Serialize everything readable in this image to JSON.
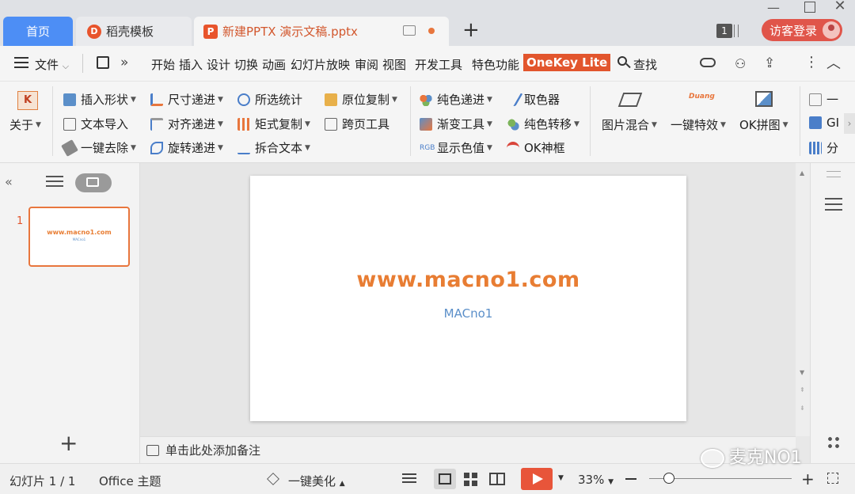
{
  "tabs": {
    "home": "首页",
    "template": "稻壳模板",
    "document": "新建PPTX 演示文稿.pptx",
    "add": "+"
  },
  "window": {
    "badge": "1",
    "login": "访客登录"
  },
  "menu": {
    "file": "文件",
    "items": [
      "开始",
      "插入",
      "设计",
      "切换",
      "动画",
      "幻灯片放映",
      "审阅",
      "视图",
      "开发工具",
      "特色功能"
    ],
    "onekey": "OneKey Lite",
    "search": "查找"
  },
  "ribbon": {
    "about": "关于",
    "insert_shape": "插入形状",
    "text_import": "文本导入",
    "one_key_remove": "一键去除",
    "size_step": "尺寸递进",
    "align_step": "对齐递进",
    "rotate_step": "旋转递进",
    "selected_stats": "所选统计",
    "matrix_copy": "矩式复制",
    "split_text": "拆合文本",
    "copy_in_place": "原位复制",
    "cross_page": "跨页工具",
    "pure_color_step": "纯色递进",
    "gradient_tool": "渐变工具",
    "show_color_value": "显示色值",
    "color_picker": "取色器",
    "pure_color_transfer": "纯色转移",
    "ok_frame": "OK神框",
    "image_blend": "图片混合",
    "one_key_effect": "一键特效",
    "ok_collage": "OK拼图",
    "duang": "Duang",
    "rgb": "RGB",
    "partial_1": "一",
    "partial_2": "GI",
    "partial_3": "分"
  },
  "slides_panel": {
    "slide_number": "1",
    "add": "+"
  },
  "slide": {
    "title": "www.macno1.com",
    "subtitle": "MACno1"
  },
  "notes": {
    "placeholder": "单击此处添加备注"
  },
  "status": {
    "slide_info": "幻灯片 1 / 1",
    "theme": "Office 主题",
    "beautify": "一键美化",
    "zoom": "33%",
    "zoom_level": 0.33
  },
  "watermark": "麦克NO1",
  "colors": {
    "accent": "#e2552d",
    "home_tab": "#4d8ef5",
    "slide_title": "#e87d33",
    "slide_subtitle": "#5b8fc9"
  }
}
